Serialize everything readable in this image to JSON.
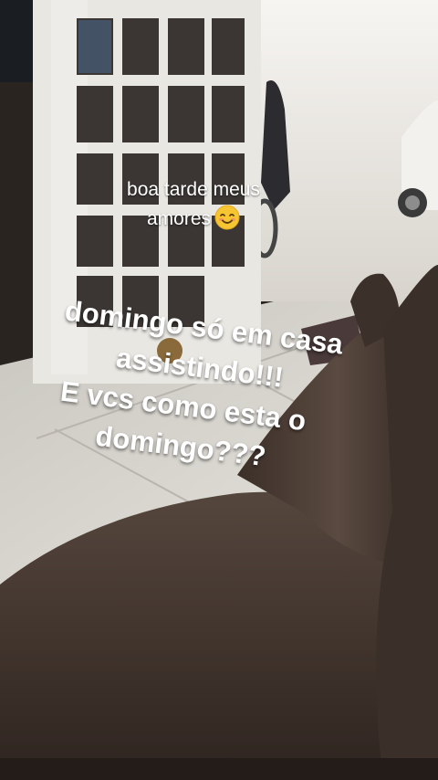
{
  "story": {
    "greeting_line1": "boa tarde meus",
    "greeting_line2": "amores",
    "greeting_emoji": "smiling-face-icon",
    "main_line1": "domingo só em casa",
    "main_line2": "assistindo!!!",
    "main_line3": "E vcs como esta o",
    "main_line4": "domingo???"
  },
  "colors": {
    "text": "#ffffff",
    "floor": "#d9d6d0",
    "door_frame": "#e9e7e2",
    "skin": "#4a3b33"
  }
}
